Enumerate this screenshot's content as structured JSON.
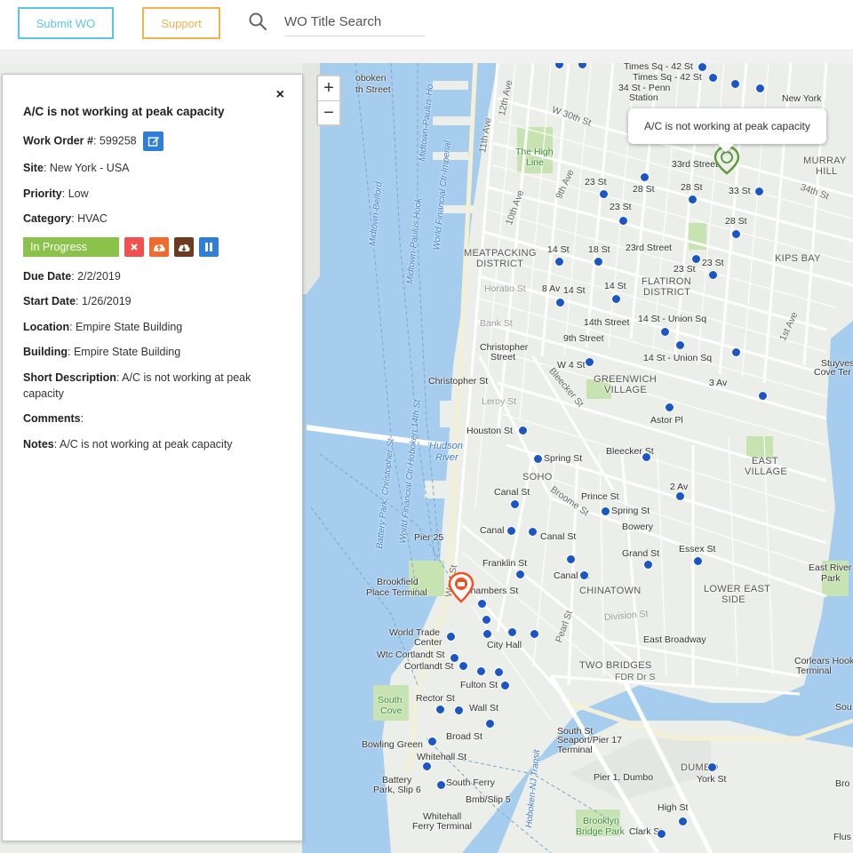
{
  "toolbar": {
    "submit_label": "Submit WO",
    "support_label": "Support",
    "search_placeholder": "WO Title Search"
  },
  "colors": {
    "submit": "#5bc5e8",
    "support": "#f3b24e",
    "status_in_progress": "#8bc34a",
    "water": "#a6cdee",
    "park": "#c8e3b2",
    "metro": "#1a56c8",
    "marker_active": "#f25022",
    "marker_hover": "#5e9c3c"
  },
  "icons": {
    "search": "search-icon",
    "edit": "edit-icon",
    "close": "close-icon",
    "cancel": "x-icon",
    "upload": "cloud-upload-icon",
    "download": "cloud-download-icon",
    "pause": "pause-icon",
    "marker": "map-pin-icon",
    "metro": "metro-icon"
  },
  "zoom": {
    "in": "+",
    "out": "−"
  },
  "workorder": {
    "title": "A/C is not working at peak capacity",
    "close": "×",
    "work_order_label": "Work Order #",
    "work_order_value": "599258",
    "site_label": "Site",
    "site_value": "New York - USA",
    "priority_label": "Priority",
    "priority_value": "Low",
    "category_label": "Category",
    "category_value": "HVAC",
    "status": "In Progress",
    "due_label": "Due Date",
    "due_value": "2/2/2019",
    "start_label": "Start Date",
    "start_value": "1/26/2019",
    "location_label": "Location",
    "location_value": "Empire State Building",
    "building_label": "Building",
    "building_value": "Empire State Building",
    "short_desc_label": "Short Description",
    "short_desc_value": "A/C is not working at peak capacity",
    "comments_label": "Comments",
    "notes_label": "Notes",
    "notes_value": "A/C is not working at peak capacity"
  },
  "tooltip": "A/C is not working at peak capacity",
  "map_labels": {
    "hoboken": "oboken",
    "hoboken2": "th Street",
    "times_sq": "Times Sq - 42 St",
    "times_sq2": "Times Sq - 42 St",
    "penn": "34 St - Penn",
    "penn2": "Station",
    "new_york": "New York",
    "murray": "MURRAY",
    "murray2": "HILL",
    "high_line": "The High",
    "high_line2": "Line",
    "st33": "33rd Street",
    "st33b": "33 St",
    "st28a": "28 St",
    "st28b": "28 St",
    "st28c": "28 St",
    "st23a": "23 St",
    "st23b": "23 St",
    "st23c": "23 St",
    "st23d": "23rd Street",
    "st23e": "23 St",
    "kips": "KIPS BAY",
    "meat": "MEATPACKING",
    "meat2": "DISTRICT",
    "st14a": "14 St",
    "st18": "18 St",
    "st14b": "14 St",
    "st14c": "14 St",
    "av8": "8 Av",
    "flatiron": "FLATIRON",
    "flatiron2": "DISTRICT",
    "st14d": "14th Street",
    "union": "14 St - Union Sq",
    "union2": "14 St - Union Sq",
    "horatio": "Horatio St",
    "bank": "Bank St",
    "christopher": "Christopher",
    "christopher2": "Street",
    "st9": "9th Street",
    "w4": "W 4 St",
    "greenwich": "GREENWICH",
    "greenwich2": "VILLAGE",
    "av3": "3 Av",
    "astor": "Astor Pl",
    "stuyves": "Stuyves",
    "stuyves2": "Cove Ter",
    "chris_st": "Christopher St",
    "leroy": "Leroy St",
    "houston": "Houston St",
    "spring": "Spring St",
    "bleecker": "Bleecker St",
    "soho": "SOHO",
    "hudson": "Hudson",
    "hudson2": "River",
    "canal": "Canal St",
    "prince": "Prince St",
    "spring2": "Spring St",
    "av2": "2 Av",
    "east_village": "EAST",
    "east_village2": "VILLAGE",
    "bowery": "Bowery",
    "canal2": "Canal St",
    "canal3": "Canal St",
    "canal4": "Canal St",
    "grand": "Grand St",
    "essex": "Essex St",
    "pier25": "Pier 25",
    "franklin": "Franklin St",
    "chinatown": "CHINATOWN",
    "les": "LOWER EAST",
    "les2": "SIDE",
    "east_river": "East River",
    "east_river2": "Park",
    "brookfield": "Brookfield",
    "brookfield2": "Place Terminal",
    "chambers": "Chambers St",
    "wtc": "World Trade",
    "wtc2": "Center",
    "city_hall": "City Hall",
    "east_bway": "East Broadway",
    "wtc_cortlandt": "Wtc Cortlandt St",
    "cortlandt": "Cortlandt St",
    "two_bridges": "TWO BRIDGES",
    "corlears": "Corlears Hook",
    "corlears2": "Terminal",
    "fulton": "Fulton St",
    "fdr": "FDR Dr S",
    "rector": "Rector St",
    "south_cove": "South",
    "south_cove2": "Cove",
    "wall": "Wall St",
    "broad": "Broad St",
    "bowling": "Bowling Green",
    "whitehall": "Whitehall St",
    "seaport": "South St",
    "seaport2": "Seaport/Pier 17",
    "seaport3": "Terminal",
    "battery": "Battery",
    "battery2": "Park, Slip 6",
    "south_ferry": "South Ferry",
    "bmb": "Bmb/Slip 5",
    "pier1": "Pier 1, Dumbo",
    "dumbo": "DUMBO",
    "york": "York St",
    "whitehall_ferry": "Whitehall",
    "whitehall_ferry2": "Ferry Terminal",
    "high_st": "High St",
    "brooklyn_bp": "Brooklyn",
    "brooklyn_bp2": "Bridge Park",
    "clark": "Clark St",
    "av11": "11th Ave",
    "av12": "12th Ave",
    "w30": "W 30th St",
    "av9": "9th Ave",
    "av10": "10th Ave",
    "ave1": "1st Ave",
    "st34": "34th St",
    "bleecker2": "Bleecker St",
    "broome": "Broome St",
    "west_st": "West St",
    "pearl": "Pearl St",
    "fdr2": "FDR Dr",
    "divison": "Division St",
    "ferry_label": "Battery Park, Christopher St",
    "ferry_label2": "World Financial Ctr-Hoboken 14th St",
    "ferry_label3": "Midtown-Paulus Hook",
    "ferry_label4": "Midtown-Belford",
    "ferry_label5": "World Financial Ctr-Imperial",
    "ferry_label6": "Hoboken-NJ Transit",
    "ferry_label7": "Midtown-Paulus-Ho",
    "bro": "Bro",
    "sou": "Sou",
    "flus": "Flus"
  }
}
